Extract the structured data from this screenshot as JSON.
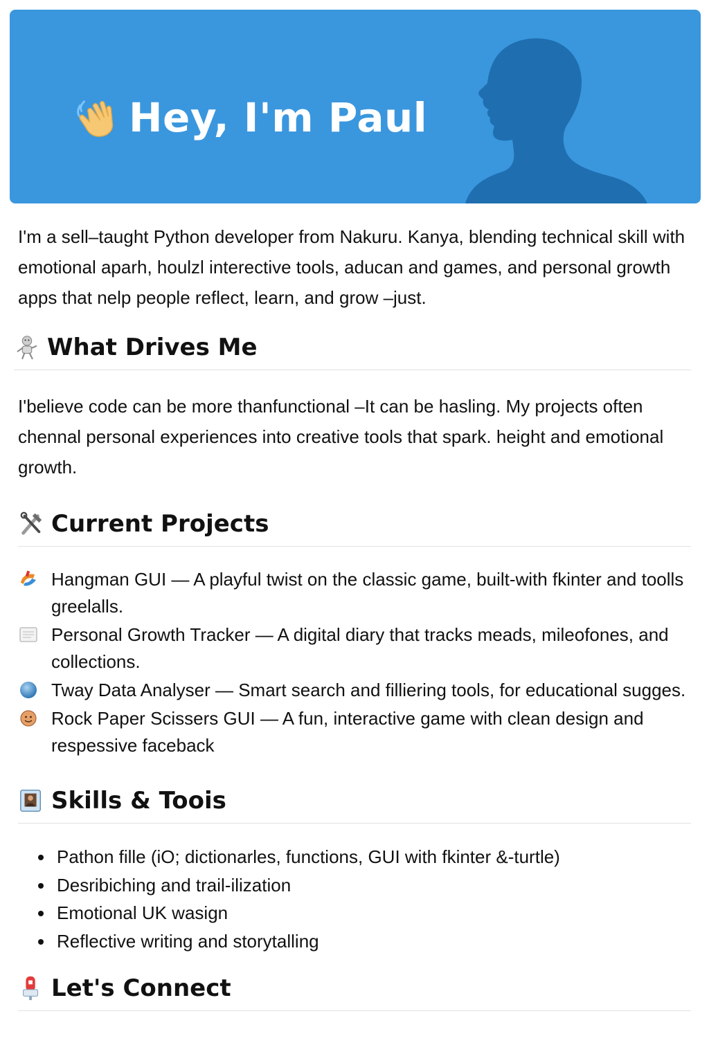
{
  "banner": {
    "title": "Hey, I'm Paul",
    "background_color": "#3a97de",
    "silhouette_color": "#1f6fb0",
    "wave_icon": "waving-hand-icon",
    "silhouette_icon": "person-silhouette"
  },
  "intro": {
    "text": "I'm a sell–taught Python developer from Nakuru. Kanya, blending technical skill with emotional aparh, houlzl interective tools, aducan and games, and personal growth apps that nelp people reflect, learn, and grow –just."
  },
  "sections": {
    "drives": {
      "heading": "What Drives Me",
      "icon": "robot-icon",
      "text": "I'believe code can be more thanfunctional –It can be hasling. My projects often chennal personal experiences into creative tools that spark. height and emotional growth."
    },
    "projects": {
      "heading": "Current Projects",
      "icon": "tools-icon",
      "items": [
        {
          "icon": "game-icon",
          "text": "Hangman GUI — A playful twist on the classic game, built-with fkinter and toolls greelalls."
        },
        {
          "icon": "notebook-icon",
          "text": "Personal Growth Tracker — A digital diary that tracks meads, mileofones, and collections."
        },
        {
          "icon": "globe-icon",
          "text": "Tway Data Analyser — Smart search and filliering tools, for educational sugges."
        },
        {
          "icon": "face-icon",
          "text": "Rock Paper Scissers GUI — A fun, interactive game with clean design and respessive faceback"
        }
      ]
    },
    "skills": {
      "heading": "Skills & Toois",
      "icon": "id-card-icon",
      "items": [
        "Pathon fille  (iO; dictionarles, functions, GUI with fkinter &-turtle)",
        "Desribiching and trail-ilization",
        "Emotional UK wasign",
        "Reflective writing and storytalling"
      ]
    },
    "connect": {
      "heading": "Let's Connect",
      "icon": "mailbox-icon"
    }
  }
}
